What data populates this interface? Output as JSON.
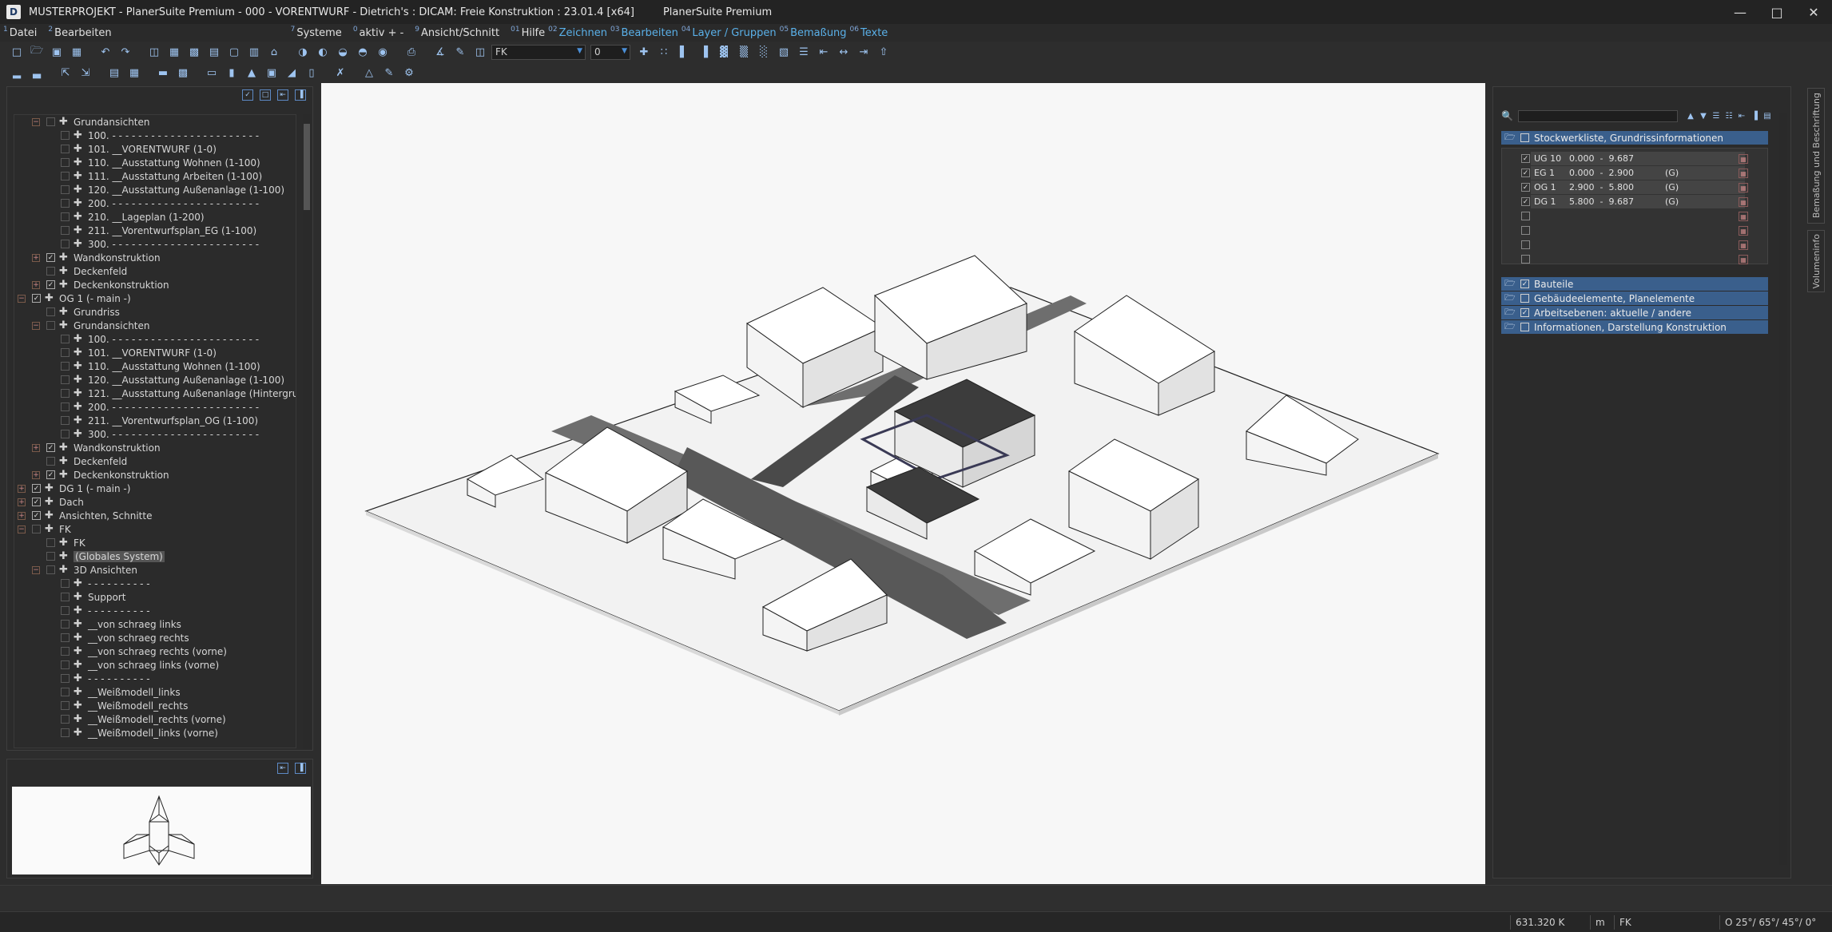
{
  "window": {
    "title": "MUSTERPROJEKT - PlanerSuite Premium - 000 - VORENTWURF - Dietrich's : DICAM: Freie Konstruktion : 23.01.4 [x64]",
    "product": "PlanerSuite Premium",
    "app_icon": "D"
  },
  "menu": [
    {
      "num": "1",
      "label": "Datei"
    },
    {
      "num": "2",
      "label": "Bearbeiten"
    },
    {
      "num": "7",
      "label": "Systeme"
    },
    {
      "num": "0",
      "label": "aktiv + -"
    },
    {
      "num": "9",
      "label": "Ansicht/Schnitt"
    },
    {
      "num": "01",
      "label": "Hilfe"
    },
    {
      "num": "02",
      "label": "Zeichnen"
    },
    {
      "num": "03",
      "label": "Bearbeiten"
    },
    {
      "num": "04",
      "label": "Layer / Gruppen"
    },
    {
      "num": "05",
      "label": "Bemaßung"
    },
    {
      "num": "06",
      "label": "Texte"
    }
  ],
  "toolbar": {
    "system_select": "FK",
    "layer_select": "0"
  },
  "tree": [
    {
      "lv": 2,
      "exp": "−",
      "cb": false,
      "label": "Grundansichten"
    },
    {
      "lv": 3,
      "cb": false,
      "label": "100. - - - - - - - - - - - - - - - - - - - - - - -"
    },
    {
      "lv": 3,
      "cb": false,
      "label": "101. __VORENTWURF (1-0)"
    },
    {
      "lv": 3,
      "cb": false,
      "label": "110. __Ausstattung Wohnen (1-100)"
    },
    {
      "lv": 3,
      "cb": false,
      "label": "111. __Ausstattung Arbeiten (1-100)"
    },
    {
      "lv": 3,
      "cb": false,
      "label": "120. __Ausstattung Außenanlage (1-100)"
    },
    {
      "lv": 3,
      "cb": false,
      "label": "200. - - - - - - - - - - - - - - - - - - - - - - -"
    },
    {
      "lv": 3,
      "cb": false,
      "label": "210. __Lageplan (1-200)"
    },
    {
      "lv": 3,
      "cb": false,
      "label": "211. __Vorentwurfsplan_EG (1-100)"
    },
    {
      "lv": 3,
      "cb": false,
      "label": "300. - - - - - - - - - - - - - - - - - - - - - - -"
    },
    {
      "lv": 2,
      "exp": "+",
      "cb": true,
      "label": "Wandkonstruktion"
    },
    {
      "lv": 2,
      "cb": false,
      "label": "Deckenfeld"
    },
    {
      "lv": 2,
      "exp": "+",
      "cb": true,
      "label": "Deckenkonstruktion"
    },
    {
      "lv": 1,
      "exp": "−",
      "cb": true,
      "label": "OG 1 (- main -)"
    },
    {
      "lv": 2,
      "cb": false,
      "label": "Grundriss"
    },
    {
      "lv": 2,
      "exp": "−",
      "cb": false,
      "label": "Grundansichten"
    },
    {
      "lv": 3,
      "cb": false,
      "label": "100. - - - - - - - - - - - - - - - - - - - - - - -"
    },
    {
      "lv": 3,
      "cb": false,
      "label": "101. __VORENTWURF (1-0)"
    },
    {
      "lv": 3,
      "cb": false,
      "label": "110. __Ausstattung Wohnen (1-100)"
    },
    {
      "lv": 3,
      "cb": false,
      "label": "120. __Ausstattung Außenanlage (1-100)"
    },
    {
      "lv": 3,
      "cb": false,
      "label": "121. __Ausstattung Außenanlage (Hintergru"
    },
    {
      "lv": 3,
      "cb": false,
      "label": "200. - - - - - - - - - - - - - - - - - - - - - - -"
    },
    {
      "lv": 3,
      "cb": false,
      "label": "211. __Vorentwurfsplan_OG (1-100)"
    },
    {
      "lv": 3,
      "cb": false,
      "label": "300. - - - - - - - - - - - - - - - - - - - - - - -"
    },
    {
      "lv": 2,
      "exp": "+",
      "cb": true,
      "label": "Wandkonstruktion"
    },
    {
      "lv": 2,
      "cb": false,
      "label": "Deckenfeld"
    },
    {
      "lv": 2,
      "exp": "+",
      "cb": true,
      "label": "Deckenkonstruktion"
    },
    {
      "lv": 1,
      "exp": "+",
      "cb": true,
      "label": "DG 1 (- main -)"
    },
    {
      "lv": 1,
      "exp": "+",
      "cb": true,
      "label": "Dach"
    },
    {
      "lv": 1,
      "exp": "+",
      "cb": true,
      "label": "Ansichten, Schnitte"
    },
    {
      "lv": 1,
      "exp": "−",
      "cb": false,
      "label": "FK"
    },
    {
      "lv": 2,
      "cb": false,
      "label": "FK"
    },
    {
      "lv": 2,
      "cb": false,
      "label": "(Globales System)",
      "hl": true
    },
    {
      "lv": 2,
      "exp": "−",
      "cb": false,
      "label": "3D Ansichten"
    },
    {
      "lv": 3,
      "cb": false,
      "label": "- - - - - - - - - -"
    },
    {
      "lv": 3,
      "cb": false,
      "label": "Support"
    },
    {
      "lv": 3,
      "cb": false,
      "label": "- - - - - - - - - -"
    },
    {
      "lv": 3,
      "cb": false,
      "label": "__von schraeg links"
    },
    {
      "lv": 3,
      "cb": false,
      "label": "__von schraeg rechts"
    },
    {
      "lv": 3,
      "cb": false,
      "label": "__von schraeg rechts (vorne)"
    },
    {
      "lv": 3,
      "cb": false,
      "label": "__von schraeg links (vorne)"
    },
    {
      "lv": 3,
      "cb": false,
      "label": "- - - - - - - - - -"
    },
    {
      "lv": 3,
      "cb": false,
      "label": "__Weißmodell_links"
    },
    {
      "lv": 3,
      "cb": false,
      "label": "__Weißmodell_rechts"
    },
    {
      "lv": 3,
      "cb": false,
      "label": "__Weißmodell_rechts (vorne)"
    },
    {
      "lv": 3,
      "cb": false,
      "label": "__Weißmodell_links (vorne)"
    }
  ],
  "right": {
    "story_header": "Stockwerkliste, Grundrissinformationen",
    "stories": [
      {
        "name": "UG 10",
        "range": "0.000  -  9.687",
        "flag": "",
        "checked": true
      },
      {
        "name": "EG 1",
        "range": "0.000  -  2.900",
        "flag": "(G)",
        "checked": true
      },
      {
        "name": "OG 1",
        "range": "2.900  -  5.800",
        "flag": "(G)",
        "checked": true
      },
      {
        "name": "DG 1",
        "range": "5.800  -  9.687",
        "flag": "(G)",
        "checked": true
      }
    ],
    "sections": [
      {
        "label": "Bauteile",
        "checked": true
      },
      {
        "label": "Gebäudeelemente, Planelemente",
        "checked": false
      },
      {
        "label": "Arbeitsebenen: aktuelle / andere",
        "checked": true
      },
      {
        "label": "Informationen, Darstellung Konstruktion",
        "checked": false
      }
    ]
  },
  "vtabs": [
    "Bemaßung und Beschriftung",
    "Volumeninfo"
  ],
  "status": {
    "size": "631.320 K",
    "unit": "m",
    "system": "FK",
    "view": "O 25°/ 65°/ 45°/ 0°"
  }
}
